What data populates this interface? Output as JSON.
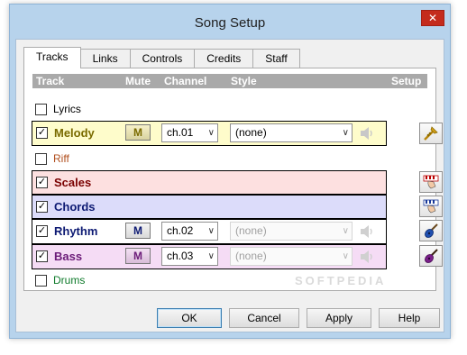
{
  "window": {
    "title": "Song Setup",
    "close_symbol": "✕"
  },
  "tabs": [
    "Tracks",
    "Links",
    "Controls",
    "Credits",
    "Staff"
  ],
  "active_tab": "Tracks",
  "headers": {
    "track": "Track",
    "mute": "Mute",
    "channel": "Channel",
    "style": "Style",
    "setup": "Setup"
  },
  "tracks": [
    {
      "name": "Lyrics",
      "checked": false,
      "color": "#000000",
      "bg": "",
      "bold": false
    },
    {
      "name": "Melody",
      "checked": true,
      "color": "#7a6b00",
      "bg": "#fefccb",
      "bold": true,
      "mute": "M",
      "channel": "ch.01",
      "style": "(none)",
      "style_enabled": true,
      "setup_icon": "trumpet-icon"
    },
    {
      "name": "Riff",
      "checked": false,
      "color": "#b04e1c",
      "bg": "",
      "bold": false
    },
    {
      "name": "Scales",
      "checked": true,
      "color": "#7a0000",
      "bg": "#fde0e0",
      "bold": true,
      "setup_icon": "piano-hand-icon"
    },
    {
      "name": "Chords",
      "checked": true,
      "color": "#0d1a73",
      "bg": "#dcdcfa",
      "bold": true,
      "setup_icon": "piano-hand-icon"
    },
    {
      "name": "Rhythm",
      "checked": true,
      "color": "#0d1a73",
      "bg": "",
      "bold": true,
      "mute": "M",
      "channel": "ch.02",
      "style": "(none)",
      "style_enabled": false,
      "setup_icon": "guitar-icon"
    },
    {
      "name": "Bass",
      "checked": true,
      "color": "#6b1b78",
      "bg": "#f5dcf5",
      "bold": true,
      "mute": "M",
      "channel": "ch.03",
      "style": "(none)",
      "style_enabled": false,
      "setup_icon": "bass-icon"
    },
    {
      "name": "Drums",
      "checked": false,
      "color": "#0e7a2a",
      "bg": "",
      "bold": false
    }
  ],
  "buttons": {
    "ok": "OK",
    "cancel": "Cancel",
    "apply": "Apply",
    "help": "Help"
  },
  "watermark": "SOFTPEDIA",
  "colors": {
    "window_frame": "#b7d3ec",
    "close_button": "#c42b1c",
    "header_bar": "#a9a9a9"
  }
}
